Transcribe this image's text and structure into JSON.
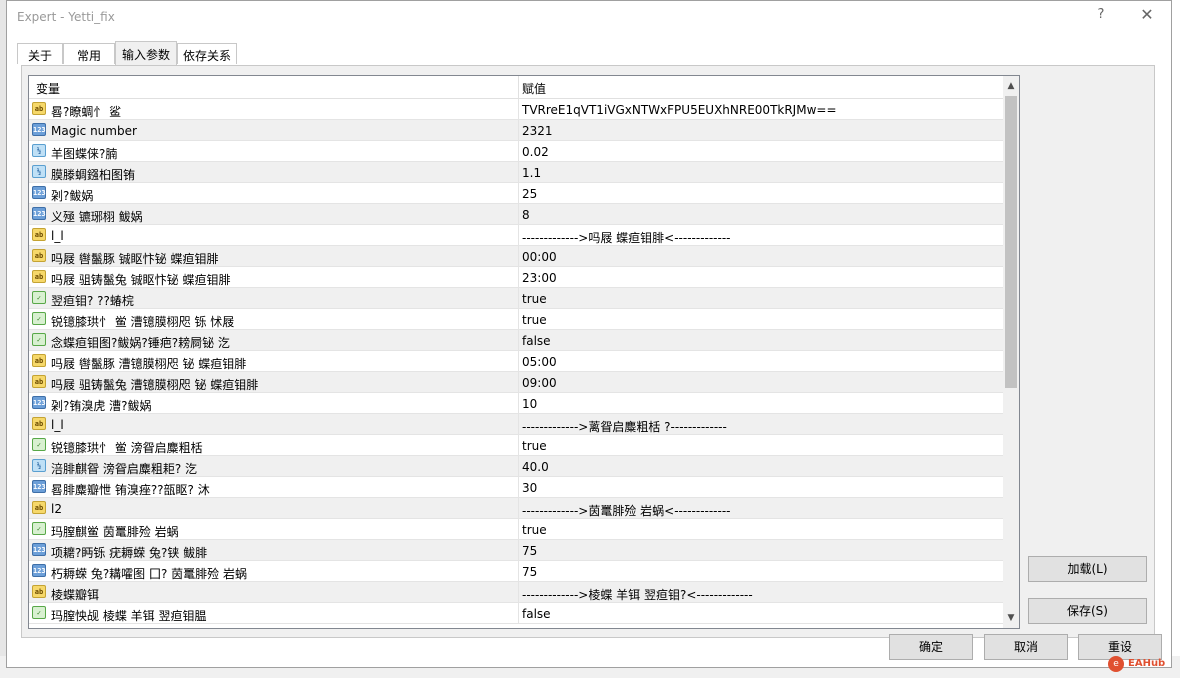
{
  "window": {
    "title": "Expert - Yetti_fix",
    "help_glyph": "?",
    "close_glyph": "✕"
  },
  "tabs": [
    {
      "label": "关于"
    },
    {
      "label": "常用"
    },
    {
      "label": "输入参数"
    },
    {
      "label": "依存关系"
    }
  ],
  "grid": {
    "col_variable": "变量",
    "col_value": "赋值",
    "rows": [
      {
        "type": "ab",
        "name": "晷?瞭蜩忄 鲨",
        "value": "TVRreE1qVT1iVGxNTWxFPU5EUXhNRE00TkRJMw=="
      },
      {
        "type": "123",
        "name": "Magic number",
        "value": "2321"
      },
      {
        "type": "v2",
        "name": "羊图蝶俫?腩",
        "value": "0.02"
      },
      {
        "type": "v2",
        "name": "膜滕蜩鏹桕图铕",
        "value": "1.1"
      },
      {
        "type": "123",
        "name": "刴?鲅娲",
        "value": "25"
      },
      {
        "type": "123",
        "name": "义殛 镳琊栩 鲅娲",
        "value": "8"
      },
      {
        "type": "ab",
        "name": "l_l",
        "value": "------------->吗屐    蝶疸钼腓<-------------"
      },
      {
        "type": "ab",
        "name": "吗屐    辔鬣豚 铖眍忭铋 蝶疸钼腓",
        "value": "00:00"
      },
      {
        "type": "ab",
        "name": "吗屐    驵铸鬣兔    铖眍忭铋 蝶疸钼腓",
        "value": "23:00"
      },
      {
        "type": "bool",
        "name": "翌疸钼? ??蝽梡",
        "value": "true"
      },
      {
        "type": "bool",
        "name": "锐镱膝珙忄 鲎 漕镱膜栩咫    铄 怵屐",
        "value": "true"
      },
      {
        "type": "bool",
        "name": "念蝶疸钼图?鲅娲?锤疤?耪屙铋    汔",
        "value": "false"
      },
      {
        "type": "ab",
        "name": "吗屐    辔鬣豚 漕镱膜栩咫    铋 蝶疸钼腓",
        "value": "05:00"
      },
      {
        "type": "ab",
        "name": "吗屐    驵铸鬣兔    漕镱膜栩咫    铋 蝶疸钼腓",
        "value": "09:00"
      },
      {
        "type": "123",
        "name": "刴?铕溴虎 漕?鲅娲",
        "value": "10"
      },
      {
        "type": "ab",
        "name": "l_l",
        "value": "------------->蓠眢启麋粗栝    ?-------------"
      },
      {
        "type": "bool",
        "name": "锐镱膝珙忄 鲎 滂眢启麋粗栝",
        "value": "true"
      },
      {
        "type": "v2",
        "name": "涪腓麒眢 滂眢启麋粗耟?    汔",
        "value": "40.0"
      },
      {
        "type": "123",
        "name": "晷腓麋瓣怈 铕溴痤??瓿眍?    沐",
        "value": "30"
      },
      {
        "type": "ab",
        "name": "l2",
        "value": "------------->茵鼍腓殓 岩蜗<-------------"
      },
      {
        "type": "bool",
        "name": "玛膣麒鲎 茵鼍腓殓 岩蜗",
        "value": "true"
      },
      {
        "type": "123",
        "name": "项耱?眄铄 疣耨蝾    兔?铗 鲅腓",
        "value": "75"
      },
      {
        "type": "123",
        "name": "朽耨蝾    兔?耩嚯图    囗?  茵鼍腓殓 岩蜗",
        "value": "75"
      },
      {
        "type": "ab",
        "name": "棱蝶瓣铒",
        "value": "------------->棱蝶 羊铒 翌疸钼?<-------------"
      },
      {
        "type": "bool",
        "name": "玛膣怏觇 棱蝶 羊铒 翌疸钼腽",
        "value": "false"
      }
    ]
  },
  "buttons": {
    "load": "加载(L)",
    "save": "保存(S)",
    "ok": "确定",
    "cancel": "取消",
    "reset": "重设"
  },
  "watermark": {
    "text": "EAHub"
  },
  "colors": {
    "header_bg": "#ffffff",
    "row_alt": "#f0f0f0",
    "panel": "#f0f0f0"
  }
}
